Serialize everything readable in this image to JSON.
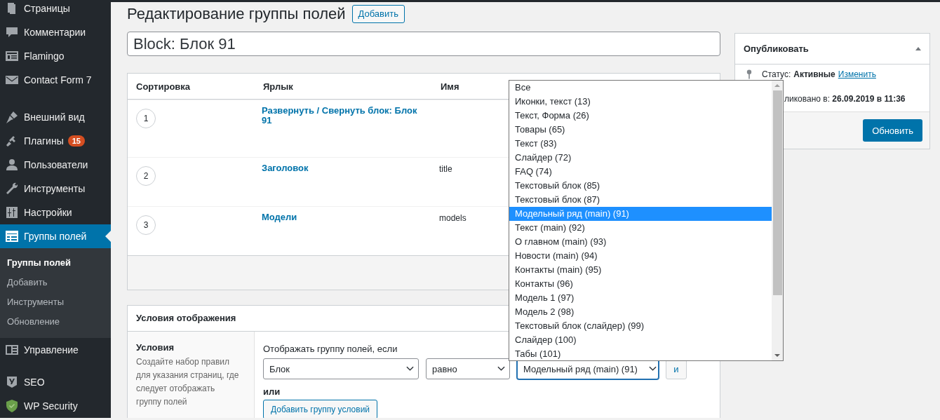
{
  "sidebar": {
    "groups": [
      [
        {
          "label": "Страницы",
          "selected": false
        },
        {
          "label": "Комментарии",
          "selected": false
        },
        {
          "label": "Flamingo",
          "selected": false
        },
        {
          "label": "Contact Form 7",
          "selected": false
        }
      ],
      [
        {
          "label": "Внешний вид",
          "selected": false
        },
        {
          "label": "Плагины",
          "badge": "15",
          "selected": false
        },
        {
          "label": "Пользователи",
          "selected": false
        },
        {
          "label": "Инструменты",
          "selected": false
        },
        {
          "label": "Настройки",
          "selected": false
        },
        {
          "label": "Группы полей",
          "selected": true,
          "children": [
            {
              "label": "Группы полей",
              "selected": true
            },
            {
              "label": "Добавить",
              "selected": false
            },
            {
              "label": "Инструменты",
              "selected": false
            },
            {
              "label": "Обновление",
              "selected": false
            }
          ]
        },
        {
          "label": "Управление",
          "selected": false
        }
      ],
      [
        {
          "label": "SEO",
          "selected": false
        },
        {
          "label": "WP Security",
          "selected": false
        }
      ]
    ]
  },
  "page": {
    "title": "Редактирование группы полей",
    "add_button": "Добавить",
    "title_field": {
      "value": "Block: Блок 91"
    }
  },
  "fields_table": {
    "columns": [
      "Сортировка",
      "Ярлык",
      "Имя"
    ],
    "rows": [
      {
        "order": "1",
        "label": "Развернуть / Свернуть блок: Блок 91",
        "name": ""
      },
      {
        "order": "2",
        "label": "Заголовок",
        "name": "title"
      },
      {
        "order": "3",
        "label": "Модели",
        "name": "models"
      }
    ]
  },
  "conditions": {
    "title": "Условия отображения",
    "side_title": "Условия",
    "side_text": "Создайте набор правил для указания страниц, где следует отображать группу полей",
    "rule_label": "Отображать группу полей, если",
    "rule": {
      "field": "Блок",
      "operator": "равно",
      "value": "Модельный ряд (main) (91)",
      "and_button": "и"
    },
    "or_label": "или",
    "add_group_button": "Добавить группу условий"
  },
  "dropdown": {
    "options": [
      {
        "label": "Все",
        "selected": false
      },
      {
        "label": "Иконки, текст (13)",
        "selected": false
      },
      {
        "label": "Текст, Форма (26)",
        "selected": false
      },
      {
        "label": "Товары (65)",
        "selected": false
      },
      {
        "label": "Текст (83)",
        "selected": false
      },
      {
        "label": "Слайдер (72)",
        "selected": false
      },
      {
        "label": "FAQ (74)",
        "selected": false
      },
      {
        "label": "Текстовый блок (85)",
        "selected": false
      },
      {
        "label": "Текстовый блок (87)",
        "selected": false
      },
      {
        "label": "Модельный ряд (main) (91)",
        "selected": true
      },
      {
        "label": "Текст (main) (92)",
        "selected": false
      },
      {
        "label": "О главном (main) (93)",
        "selected": false
      },
      {
        "label": "Новости (main) (94)",
        "selected": false
      },
      {
        "label": "Контакты (main) (95)",
        "selected": false
      },
      {
        "label": "Контакты (96)",
        "selected": false
      },
      {
        "label": "Модель 1 (97)",
        "selected": false
      },
      {
        "label": "Модель 2 (98)",
        "selected": false
      },
      {
        "label": "Текстовый блок (слайдер) (99)",
        "selected": false
      },
      {
        "label": "Слайдер (100)",
        "selected": false
      },
      {
        "label": "Табы (101)",
        "selected": false
      }
    ]
  },
  "publish": {
    "title": "Опубликовать",
    "status_label": "Статус:",
    "status_value": "Активные",
    "status_link": "Изменить",
    "published_text": "ликовано в: **26.09.2019 в 11:36**",
    "update_button": "Обновить"
  }
}
